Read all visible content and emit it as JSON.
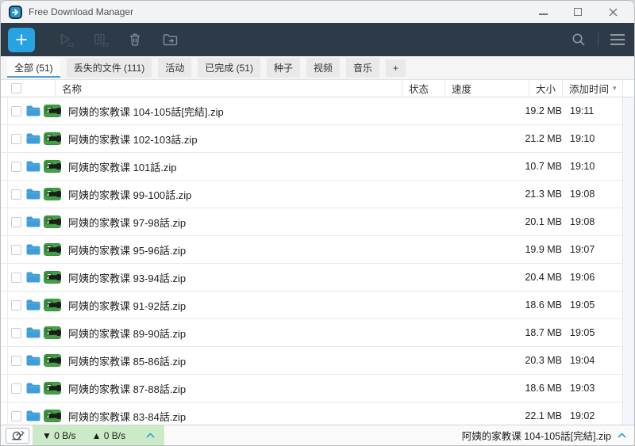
{
  "window": {
    "title": "Free Download Manager"
  },
  "toolbar": {
    "buttons": [
      {
        "name": "add-download",
        "icon": "plus-icon"
      },
      {
        "name": "start-all",
        "icon": "play-icon",
        "disabled": true
      },
      {
        "name": "pause-all",
        "icon": "pause-icon",
        "disabled": true
      },
      {
        "name": "delete",
        "icon": "trash-icon"
      },
      {
        "name": "open-folder",
        "icon": "folder-export-icon"
      },
      {
        "name": "search",
        "icon": "magnifier-icon"
      },
      {
        "name": "menu",
        "icon": "hamburger-icon"
      }
    ]
  },
  "tabs": [
    {
      "label": "全部 (51)",
      "active": true
    },
    {
      "label": "丢失的文件 (111)",
      "active": false
    },
    {
      "label": "活动",
      "active": false
    },
    {
      "label": "已完成 (51)",
      "active": false
    },
    {
      "label": "种子",
      "active": false
    },
    {
      "label": "视频",
      "active": false
    },
    {
      "label": "音乐",
      "active": false
    },
    {
      "label": "+",
      "active": false
    }
  ],
  "table": {
    "columns": [
      "名称",
      "状态",
      "速度",
      "大小",
      "添加时间"
    ],
    "sort": {
      "column": "添加时间",
      "direction": "desc",
      "glyph": "▾"
    },
    "rows": [
      {
        "name": "阿姨的家教课 104-105話[完結].zip",
        "status": "",
        "speed": "",
        "size": "19.2 MB",
        "time": "19:11"
      },
      {
        "name": "阿姨的家教课 102-103話.zip",
        "status": "",
        "speed": "",
        "size": "21.2 MB",
        "time": "19:10"
      },
      {
        "name": "阿姨的家教课 101話.zip",
        "status": "",
        "speed": "",
        "size": "10.7 MB",
        "time": "19:10"
      },
      {
        "name": "阿姨的家教课 99-100話.zip",
        "status": "",
        "speed": "",
        "size": "21.3 MB",
        "time": "19:08"
      },
      {
        "name": "阿姨的家教课 97-98話.zip",
        "status": "",
        "speed": "",
        "size": "20.1 MB",
        "time": "19:08"
      },
      {
        "name": "阿姨的家教课 95-96話.zip",
        "status": "",
        "speed": "",
        "size": "19.9 MB",
        "time": "19:07"
      },
      {
        "name": "阿姨的家教课 93-94話.zip",
        "status": "",
        "speed": "",
        "size": "20.4 MB",
        "time": "19:06"
      },
      {
        "name": "阿姨的家教课 91-92話.zip",
        "status": "",
        "speed": "",
        "size": "18.6 MB",
        "time": "19:05"
      },
      {
        "name": "阿姨的家教课 89-90話.zip",
        "status": "",
        "speed": "",
        "size": "18.7 MB",
        "time": "19:05"
      },
      {
        "name": "阿姨的家教课 85-86話.zip",
        "status": "",
        "speed": "",
        "size": "20.3 MB",
        "time": "19:04"
      },
      {
        "name": "阿姨的家教课 87-88話.zip",
        "status": "",
        "speed": "",
        "size": "18.6 MB",
        "time": "19:03"
      },
      {
        "name": "阿姨的家教课 83-84話.zip",
        "status": "",
        "speed": "",
        "size": "22.1 MB",
        "time": "19:02"
      }
    ]
  },
  "statusbar": {
    "download_speed": "▼ 0 B/s",
    "upload_speed": "▲ 0 B/s",
    "current_file": "阿姨的家教课 104-105話[完結].zip",
    "snail_icon": "speed-limit-snail-icon"
  },
  "colors": {
    "accent_blue": "#27a3e1",
    "toolbar_bg": "#2d3a48",
    "tab_underline": "#4e9fd6",
    "speed_panel_green": "#cdeac8",
    "folder_icon_blue": "#3f9ed8",
    "zip_icon_green": "#43a047"
  }
}
